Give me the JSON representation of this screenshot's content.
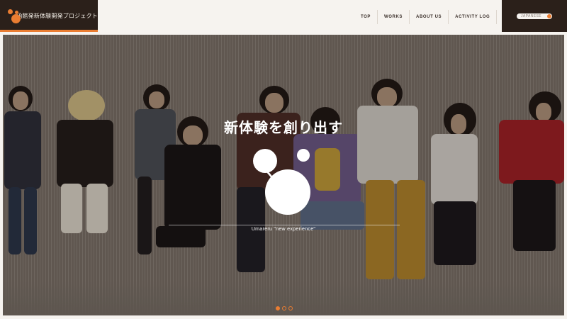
{
  "header": {
    "logo_text": "函館発新体験開発プロジェクト",
    "nav": [
      "TOP",
      "WORKS",
      "ABOUT US",
      "ACTIVITY LOG"
    ],
    "language": "JAPANESE"
  },
  "hero": {
    "title": "新体験を創り出す",
    "caption": "Umareru \"new experience\"",
    "slides": 3,
    "active_slide": 1
  },
  "colors": {
    "accent": "#ea7d32",
    "dark": "#2b201a",
    "background": "#f6f3ef"
  }
}
